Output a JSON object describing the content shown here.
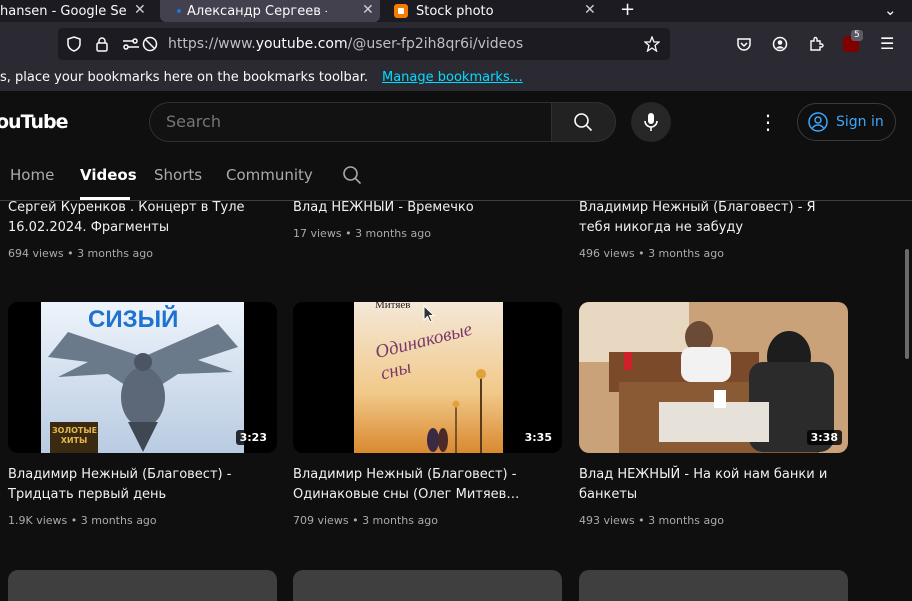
{
  "browser": {
    "tabs": [
      {
        "title": "hansen - Google Se",
        "active": false
      },
      {
        "title": "Александр Сергеев - Yo",
        "active": true
      },
      {
        "title": "Stock photo",
        "active": false
      }
    ],
    "url_prefix": "https://www.",
    "url_host": "youtube.com",
    "url_path": "/@user-fp2ih8qr6i/videos",
    "extension_badge": "5",
    "bookmarks_text": "s, place your bookmarks here on the bookmarks toolbar.",
    "bookmarks_link": "Manage bookmarks…"
  },
  "youtube": {
    "logo": "ouTube",
    "search_placeholder": "Search",
    "signin_label": "Sign in",
    "channel_tabs": [
      "Home",
      "Videos",
      "Shorts",
      "Community"
    ],
    "active_tab": "Videos"
  },
  "videos_row1": [
    {
      "title": "Сергей Куренков . Концерт в Туле 16.02.2024. Фрагменты",
      "views": "694 views",
      "age": "3 months ago"
    },
    {
      "title": "Влад НЕЖНЫЙ - Времечко",
      "views": "17 views",
      "age": "3 months ago"
    },
    {
      "title": "Владимир Нежный (Благовест) - Я тебя никогда не забуду",
      "views": "496 views",
      "age": "3 months ago"
    }
  ],
  "videos_row2": [
    {
      "title": "Владимир Нежный (Благовест) - Тридцать первый день",
      "views": "1.9K views",
      "age": "3 months ago",
      "duration": "3:23",
      "thumb_text": "СИЗЫЙ",
      "thumb_text2": "ЗОЛОТЫЕ ХИТЫ"
    },
    {
      "title": "Владимир Нежный (Благовест) - Одинаковые сны (Олег Митяев…",
      "views": "709 views",
      "age": "3 months ago",
      "duration": "3:35",
      "thumb_text": "Митяев",
      "thumb_text2": "Одинаковые сны"
    },
    {
      "title": "Влад НЕЖНЫЙ - На кой нам банки и банкеты",
      "views": "493 views",
      "age": "3 months ago",
      "duration": "3:38"
    }
  ],
  "meta_separator": "•",
  "colors": {
    "accent_link": "#3ea6ff",
    "background": "#0f0f0f",
    "bookmark_link": "#00ddff"
  }
}
